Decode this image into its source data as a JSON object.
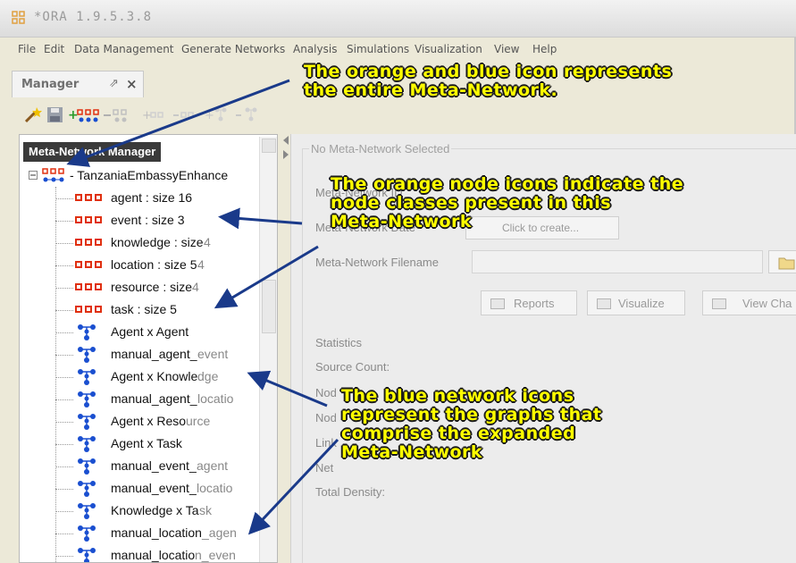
{
  "window": {
    "title": "*ORA 1.9.5.3.8"
  },
  "menu": {
    "items": [
      "File",
      "Edit",
      "Data Management",
      "Generate Networks",
      "Analysis",
      "Simulations",
      "Visualization",
      "View",
      "Help"
    ]
  },
  "manager_tab": {
    "label": "Manager",
    "pin_glyph": "⇗",
    "close_glyph": "×"
  },
  "tree": {
    "header": "Meta-Network Manager",
    "root_label": "- TanzaniaEmbassyEnhance",
    "items": [
      {
        "kind": "node",
        "text": "agent : size 16",
        "fade": ""
      },
      {
        "kind": "node",
        "text": "event : size 3",
        "fade": ""
      },
      {
        "kind": "node",
        "text": "knowledge : size",
        "fade": " 4"
      },
      {
        "kind": "node",
        "text": "location : size 5",
        "fade": "4"
      },
      {
        "kind": "node",
        "text": "resource : size",
        "fade": " 4"
      },
      {
        "kind": "node",
        "text": "task : size 5",
        "fade": ""
      },
      {
        "kind": "net",
        "text": "Agent x Agent",
        "fade": ""
      },
      {
        "kind": "net",
        "text": "manual_agent_",
        "fade": "event"
      },
      {
        "kind": "net",
        "text": "Agent x Knowle",
        "fade": "dge"
      },
      {
        "kind": "net",
        "text": "manual_agent_",
        "fade": "locatio"
      },
      {
        "kind": "net",
        "text": "Agent x Reso",
        "fade": "urce"
      },
      {
        "kind": "net",
        "text": "Agent x Task",
        "fade": ""
      },
      {
        "kind": "net",
        "text": "manual_event_",
        "fade": "agent"
      },
      {
        "kind": "net",
        "text": "manual_event_",
        "fade": "locatio"
      },
      {
        "kind": "net",
        "text": "Knowledge x Ta",
        "fade": "sk"
      },
      {
        "kind": "net",
        "text": "manual_location",
        "fade": "_agen"
      },
      {
        "kind": "net",
        "text": "manual_locatio",
        "fade": "n_even"
      }
    ]
  },
  "details": {
    "title": "No Meta-Network Selected",
    "fields": {
      "id_label": "Meta-Network ID",
      "date_label": "Meta-Network Date",
      "filename_label": "Meta-Network Filename",
      "create_button": "Click to create...",
      "statistics_label": "Statistics",
      "source_count_label": "Source Count:",
      "node_label_1": "Nod",
      "node_label_2": "Nod",
      "link_label": "Link",
      "net_label": "Net",
      "total_density_label": "Total Density:"
    },
    "buttons": {
      "reports": "Reports",
      "visualize": "Visualize",
      "view_chart": "View Cha"
    }
  },
  "annotations": {
    "meta_network": "The orange and blue icon represents\nthe entire Meta-Network.",
    "node_icons": "The orange node icons indicate the\nnode classes present in this\nMeta-Network",
    "network_icons": "The blue network icons\nrepresent the graphs that\ncomprise the expanded\nMeta-Network"
  },
  "colors": {
    "annotation_fill": "#ffff00",
    "annotation_outline": "#1a1a1a",
    "arrow": "#1a3a8a",
    "node_icon": "#e03010",
    "network_icon": "#1a4fd0"
  }
}
